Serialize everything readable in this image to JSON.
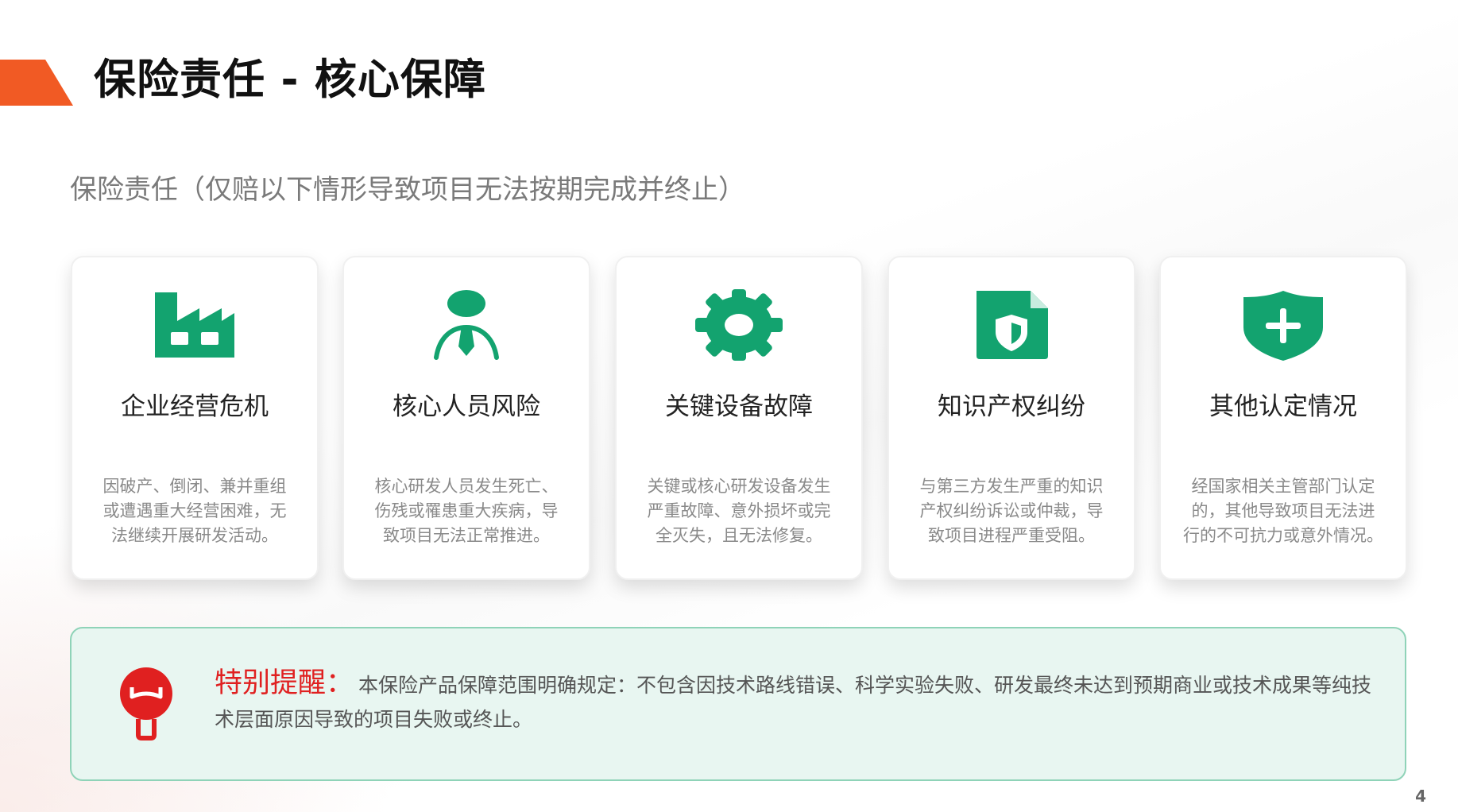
{
  "slide": {
    "title": "保险责任 - 核心保障",
    "subtitle": "保险责任（仅赔以下情形导致项目无法按期完成并终止）",
    "page_number": "4"
  },
  "colors": {
    "accent": "#f15a24",
    "icon_green": "#13a36f",
    "alert_red": "#e02020",
    "notice_bg": "#e8f6f1",
    "notice_border": "#8fd3b8"
  },
  "cards": [
    {
      "icon": "factory-icon",
      "title": "企业经营危机",
      "desc_lines": [
        "因破产、倒闭、兼并重组",
        "或遭遇重大经营困难，无",
        "法继续开展研发活动。"
      ]
    },
    {
      "icon": "person-tie-icon",
      "title": "核心人员风险",
      "desc_lines": [
        "核心研发人员发生死亡、",
        "伤残或罹患重大疾病，导",
        "致项目无法正常推进。"
      ]
    },
    {
      "icon": "gear-icon",
      "title": "关键设备故障",
      "desc_lines": [
        "关键或核心研发设备发生",
        "严重故障、意外损坏或完",
        "全灭失，且无法修复。"
      ]
    },
    {
      "icon": "document-shield-icon",
      "title": "知识产权纠纷",
      "desc_lines": [
        "与第三方发生严重的知识",
        "产权纠纷诉讼或仲裁，导",
        "致项目进程严重受阻。"
      ]
    },
    {
      "icon": "shield-plus-icon",
      "title": "其他认定情况",
      "desc_lines": [
        "经国家相关主管部门认定",
        "的，其他导致项目无法进",
        "行的不可抗力或意外情况。"
      ]
    }
  ],
  "notice": {
    "icon": "lightbulb-icon",
    "label": "特别提醒：",
    "text": "本保险产品保障范围明确规定：不包含因技术路线错误、科学实验失败、研发最终未达到预期商业或技术成果等纯技术层面原因导致的项目失败或终止。"
  }
}
